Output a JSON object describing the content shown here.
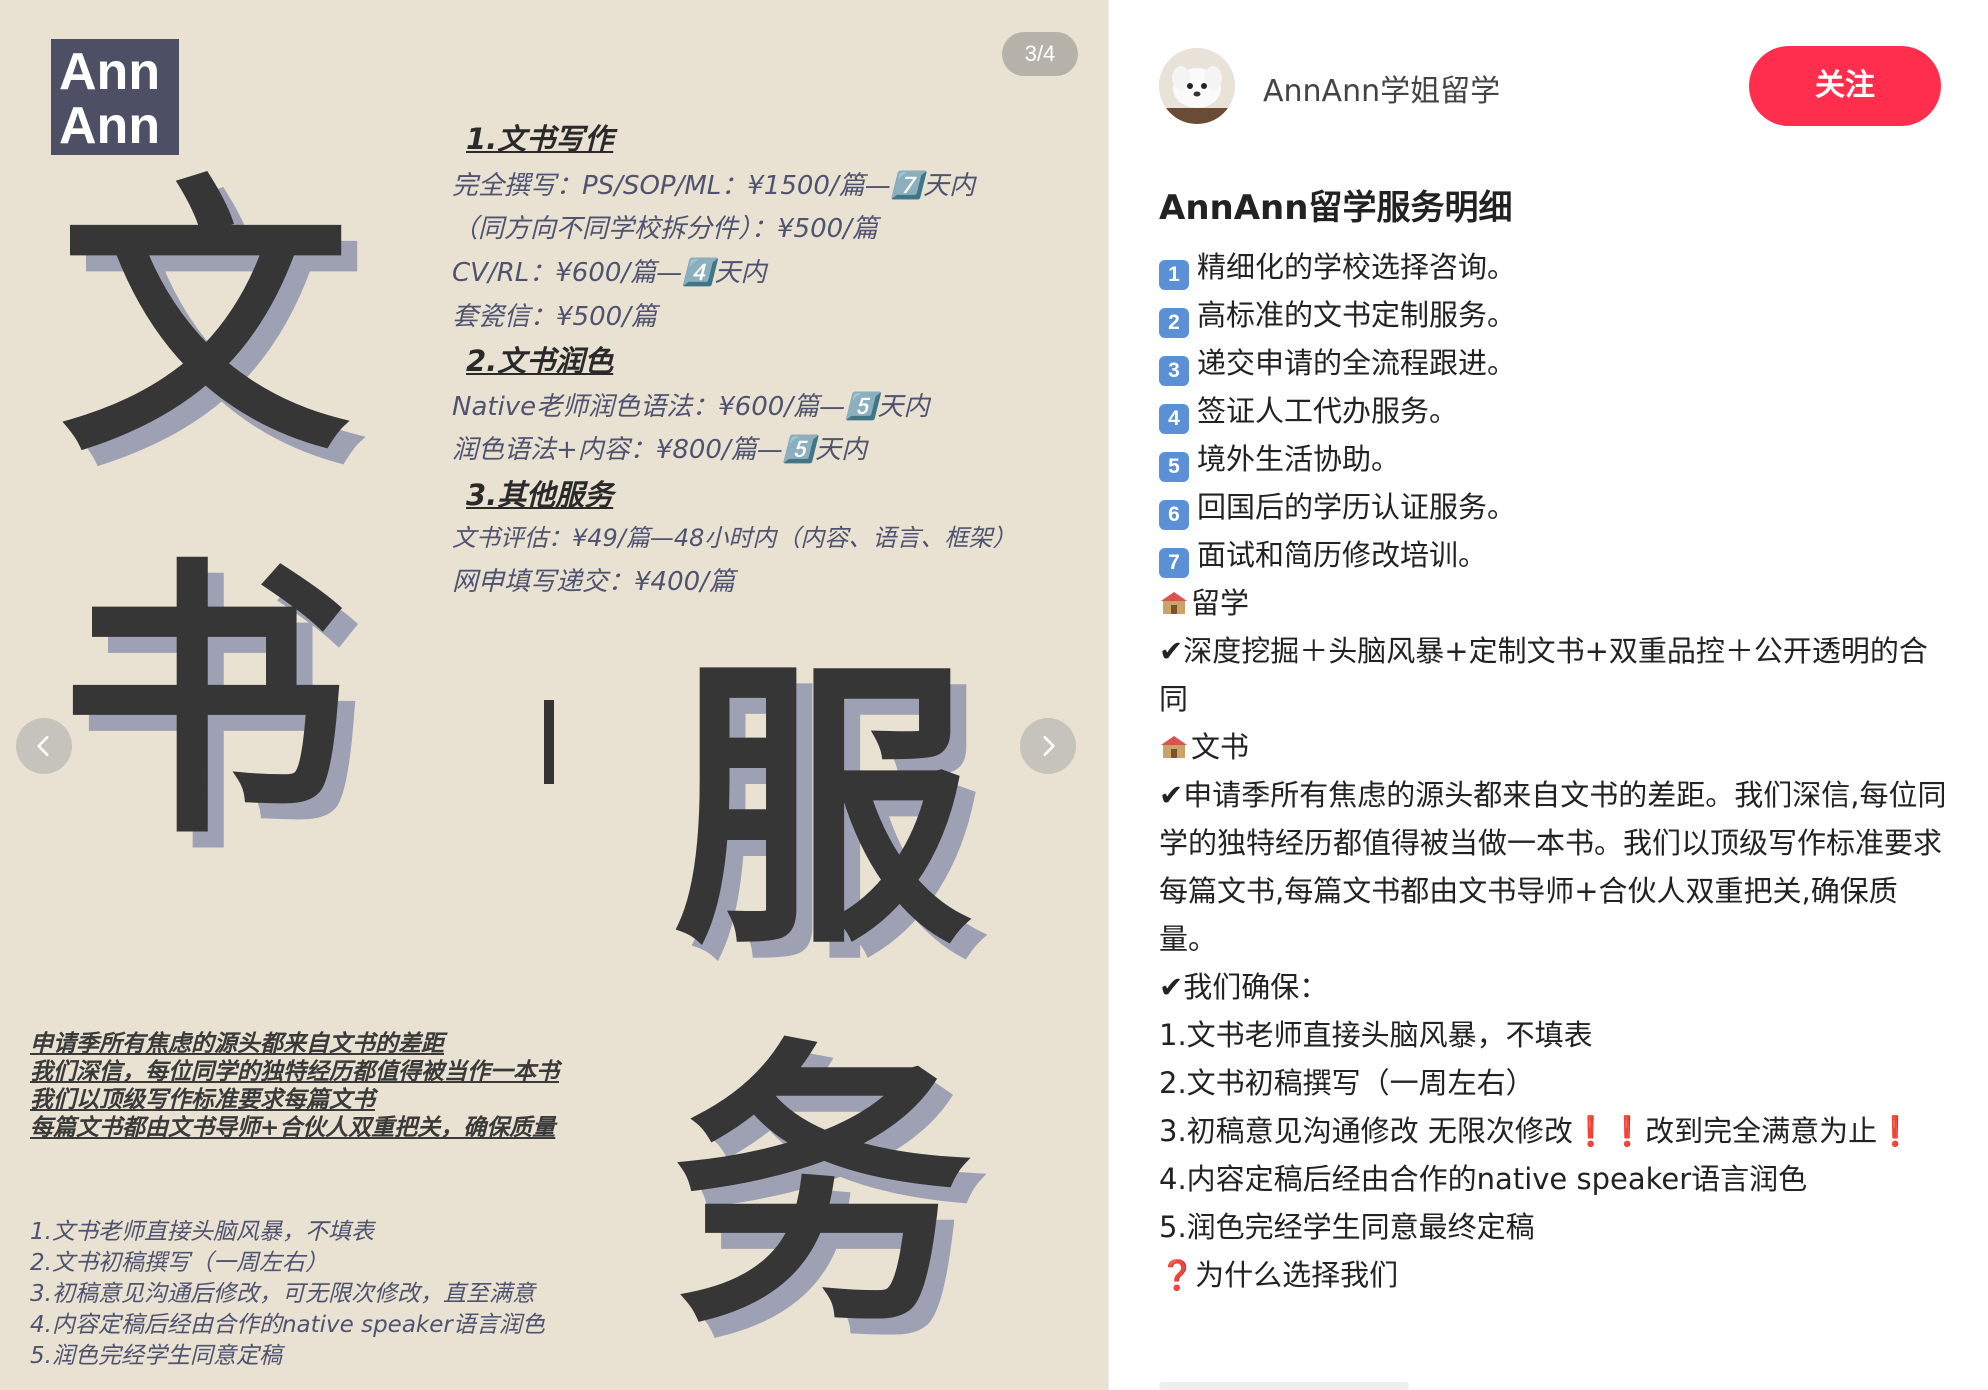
{
  "carousel": {
    "counter": "3/4",
    "prev_icon": "chevron-left-icon",
    "next_icon": "chevron-right-icon",
    "logo": [
      "Ann",
      "Ann"
    ],
    "big_chars": [
      "文",
      "书",
      "服",
      "务"
    ],
    "sections": [
      {
        "heading": "1.文书写作",
        "lines": [
          "完全撰写：PS/SOP/ML：¥1500/篇—7️⃣天内",
          "（同方向不同学校拆分件）：¥500/篇",
          "CV/RL：¥600/篇—4️⃣天内",
          "套瓷信：¥500/篇"
        ]
      },
      {
        "heading": "2.文书润色",
        "lines": [
          "Native老师润色语法：¥600/篇—5️⃣天内",
          "润色语法+内容：¥800/篇—5️⃣天内"
        ]
      },
      {
        "heading": "3.其他服务",
        "lines": [
          "文书评估：¥49/篇—48小时内（内容、语言、框架）",
          "网申填写递交：¥400/篇"
        ]
      }
    ],
    "bold_block": [
      "申请季所有焦虑的源头都来自文书的差距",
      "我们深信，每位同学的独特经历都值得被当作一本书",
      "我们以顶级写作标准要求每篇文书",
      "每篇文书都由文书导师+合伙人双重把关，确保质量"
    ],
    "list_block": [
      "1.文书老师直接头脑风暴，不填表",
      "2.文书初稿撰写（一周左右）",
      "3.初稿意见沟通后修改，可无限次修改，直至满意",
      "4.内容定稿后经由合作的native speaker语言润色",
      "5.润色完经学生同意定稿"
    ]
  },
  "author": {
    "name": "AnnAnn学姐留学",
    "follow_label": "关注"
  },
  "note": {
    "title": "AnnAnn留学服务明细",
    "services": [
      {
        "num": "1",
        "text": "精细化的学校选择咨询。"
      },
      {
        "num": "2",
        "text": "高标准的文书定制服务。"
      },
      {
        "num": "3",
        "text": "递交申请的全流程跟进。"
      },
      {
        "num": "4",
        "text": "签证人工代办服务。"
      },
      {
        "num": "5",
        "text": "境外生活协助。"
      },
      {
        "num": "6",
        "text": "回国后的学历认证服务。"
      },
      {
        "num": "7",
        "text": "面试和简历修改培训。"
      }
    ],
    "study_label": "留学",
    "study_text": "✔深度挖掘＋头脑风暴+定制文书+双重品控＋公开透明的合同",
    "docs_label": "文书",
    "docs_text": "✔申请季所有焦虑的源头都来自文书的差距。我们深信,每位同学的独特经历都值得被当做一本书。我们以顶级写作标准要求每篇文书,每篇文书都由文书导师+合伙人双重把关,确保质量。",
    "ensure_label": "✔我们确保：",
    "steps": [
      "1.文书老师直接头脑风暴，不填表",
      "2.文书初稿撰写（一周左右）",
      "3.初稿意见沟通修改 无限次修改",
      "改到完全满意为止",
      "4.内容定稿后经由合作的native speaker语言润色",
      "5.润色完经学生同意最终定稿"
    ],
    "why_label": "为什么选择我们",
    "accent_color": "#ff2e4d",
    "exclaim_color": "#e3242b"
  }
}
